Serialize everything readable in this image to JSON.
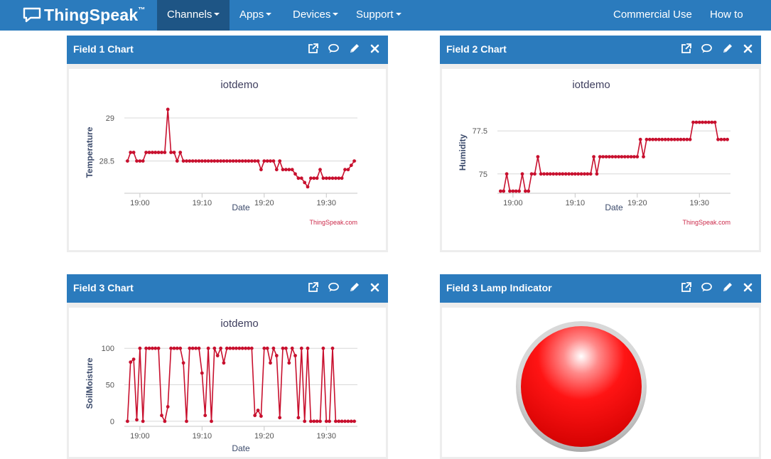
{
  "brand": {
    "name": "ThingSpeak",
    "tm": "™"
  },
  "nav": {
    "channels": "Channels",
    "apps": "Apps",
    "devices": "Devices",
    "support": "Support",
    "commercial": "Commercial Use",
    "buy": "How to Buy"
  },
  "panels": {
    "p1": {
      "title": "Field 1 Chart"
    },
    "p2": {
      "title": "Field 2 Chart"
    },
    "p3": {
      "title": "Field 3 Chart"
    },
    "p4": {
      "title": "Field 3 Lamp Indicator"
    }
  },
  "tool_icons": [
    "external-link-icon",
    "comment-icon",
    "pencil-icon",
    "close-icon"
  ],
  "lamp": {
    "state": "on",
    "color": "#ff0000"
  },
  "colors": {
    "navbar": "#2b7bbd",
    "active_nav": "#1e5585",
    "series": "#c8102e"
  },
  "chart_data": [
    {
      "type": "line",
      "title": "iotdemo",
      "xlabel": "Date",
      "ylabel": "Temperature",
      "credit": "ThingSpeak.com",
      "x_ticks": [
        "19:00",
        "19:10",
        "19:20",
        "19:30"
      ],
      "y_ticks": [
        28.5,
        29
      ],
      "x_range_minutes": [
        -2.5,
        35
      ],
      "ylim": [
        28.15,
        29.05
      ],
      "x_minutes": [
        -2.0,
        -1.5,
        -1.0,
        -0.5,
        0,
        0.5,
        1,
        1.5,
        2,
        2.5,
        3,
        3.5,
        4,
        4.5,
        5,
        5.5,
        6,
        6.5,
        7,
        7.5,
        8,
        8.5,
        9,
        9.5,
        10,
        10.5,
        11,
        11.5,
        12,
        12.5,
        13,
        13.5,
        14,
        14.5,
        15,
        15.5,
        16,
        16.5,
        17,
        17.5,
        18,
        18.5,
        19,
        19.5,
        20,
        20.5,
        21,
        21.5,
        22,
        22.5,
        23,
        23.5,
        24,
        24.5,
        25,
        25.5,
        26,
        26.5,
        27,
        27.5,
        28,
        28.5,
        29,
        29.5,
        30,
        30.5,
        31,
        31.5,
        32,
        32.5,
        33,
        33.5,
        34,
        34.5
      ],
      "values": [
        28.5,
        28.6,
        28.6,
        28.5,
        28.5,
        28.5,
        28.6,
        28.6,
        28.6,
        28.6,
        28.6,
        28.6,
        28.6,
        29.1,
        28.6,
        28.6,
        28.5,
        28.6,
        28.5,
        28.5,
        28.5,
        28.5,
        28.5,
        28.5,
        28.5,
        28.5,
        28.5,
        28.5,
        28.5,
        28.5,
        28.5,
        28.5,
        28.5,
        28.5,
        28.5,
        28.5,
        28.5,
        28.5,
        28.5,
        28.5,
        28.5,
        28.5,
        28.5,
        28.4,
        28.5,
        28.5,
        28.5,
        28.5,
        28.4,
        28.5,
        28.4,
        28.4,
        28.4,
        28.4,
        28.35,
        28.3,
        28.3,
        28.25,
        28.2,
        28.3,
        28.3,
        28.3,
        28.4,
        28.3,
        28.3,
        28.3,
        28.3,
        28.3,
        28.3,
        28.3,
        28.4,
        28.4,
        28.45,
        28.5
      ]
    },
    {
      "type": "line",
      "title": "iotdemo",
      "xlabel": "Date",
      "ylabel": "Humidity",
      "credit": "ThingSpeak.com",
      "x_ticks": [
        "19:00",
        "19:10",
        "19:20",
        "19:30"
      ],
      "y_ticks": [
        75,
        77.5
      ],
      "x_range_minutes": [
        -2.5,
        35
      ],
      "ylim": [
        74.0,
        78.5
      ],
      "x_minutes": [
        -2.0,
        -1.5,
        -1.0,
        -0.5,
        0,
        0.5,
        1,
        1.5,
        2,
        2.5,
        3,
        3.5,
        4,
        4.5,
        5,
        5.5,
        6,
        6.5,
        7,
        7.5,
        8,
        8.5,
        9,
        9.5,
        10,
        10.5,
        11,
        11.5,
        12,
        12.5,
        13,
        13.5,
        14,
        14.5,
        15,
        15.5,
        16,
        16.5,
        17,
        17.5,
        18,
        18.5,
        19,
        19.5,
        20,
        20.5,
        21,
        21.5,
        22,
        22.5,
        23,
        23.5,
        24,
        24.5,
        25,
        25.5,
        26,
        26.5,
        27,
        27.5,
        28,
        28.5,
        29,
        29.5,
        30,
        30.5,
        31,
        31.5,
        32,
        32.5,
        33,
        33.5,
        34,
        34.5
      ],
      "values": [
        74,
        74,
        75,
        74,
        74,
        74,
        74,
        75,
        74,
        74,
        75,
        75,
        76,
        75,
        75,
        75,
        75,
        75,
        75,
        75,
        75,
        75,
        75,
        75,
        75,
        75,
        75,
        75,
        75,
        75,
        76,
        75,
        76,
        76,
        76,
        76,
        76,
        76,
        76,
        76,
        76,
        76,
        76,
        76,
        76,
        77,
        76,
        77,
        77,
        77,
        77,
        77,
        77,
        77,
        77,
        77,
        77,
        77,
        77,
        77,
        77,
        77,
        78,
        78,
        78,
        78,
        78,
        78,
        78,
        78,
        77,
        77,
        77,
        77
      ]
    },
    {
      "type": "line",
      "title": "iotdemo",
      "xlabel": "Date",
      "ylabel": "SoilMoisture",
      "x_ticks": [
        "19:00",
        "19:10",
        "19:20",
        "19:30"
      ],
      "y_ticks": [
        0,
        50,
        100
      ],
      "x_range_minutes": [
        -2.5,
        35
      ],
      "ylim": [
        -4,
        108
      ],
      "x_minutes": [
        -2.0,
        -1.5,
        -1.0,
        -0.5,
        0,
        0.5,
        1,
        1.5,
        2,
        2.5,
        3,
        3.5,
        4,
        4.5,
        5,
        5.5,
        6,
        6.5,
        7,
        7.5,
        8,
        8.5,
        9,
        9.5,
        10,
        10.5,
        11,
        11.5,
        12,
        12.5,
        13,
        13.5,
        14,
        14.5,
        15,
        15.5,
        16,
        16.5,
        17,
        17.5,
        18,
        18.5,
        19,
        19.5,
        20,
        20.5,
        21,
        21.5,
        22,
        22.5,
        23,
        23.5,
        24,
        24.5,
        25,
        25.5,
        26,
        26.5,
        27,
        27.5,
        28,
        28.5,
        29,
        29.5,
        30,
        30.5,
        31,
        31.5,
        32,
        32.5,
        33,
        33.5,
        34,
        34.5
      ],
      "values": [
        0,
        81,
        85,
        2,
        100,
        0,
        100,
        100,
        100,
        100,
        100,
        8,
        0,
        20,
        100,
        100,
        100,
        100,
        80,
        0,
        100,
        100,
        100,
        100,
        66,
        8,
        100,
        0,
        100,
        90,
        100,
        80,
        100,
        100,
        100,
        100,
        100,
        100,
        100,
        100,
        100,
        8,
        15,
        7,
        100,
        100,
        80,
        100,
        90,
        5,
        100,
        100,
        80,
        100,
        90,
        5,
        100,
        0,
        100,
        0,
        0,
        0,
        0,
        100,
        0,
        0,
        100,
        0,
        0,
        0,
        0,
        0,
        0,
        0
      ]
    }
  ]
}
